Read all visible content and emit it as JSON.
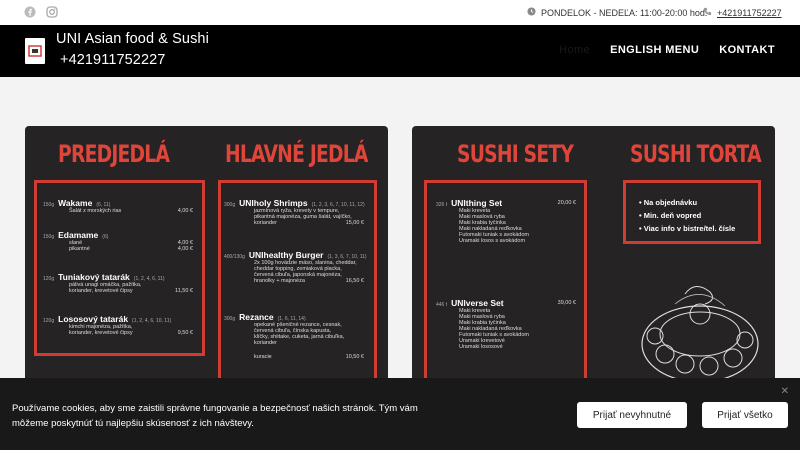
{
  "topbar": {
    "hours": "PONDELOK - NEDEĽA: 11:00-20:00 hod.",
    "phone": "+421911752227"
  },
  "header": {
    "brand_name": "UNI Asian food & Sushi",
    "brand_phone": "+421911752227",
    "nav": {
      "home": "Home",
      "english_menu": "ENGLISH MENU",
      "contact": "KONTAKT"
    }
  },
  "menu_left": {
    "title_1": "PREDJEDLÁ",
    "title_2": "HLAVNÉ JEDLÁ",
    "starters": [
      {
        "gram": "150g",
        "name": "Wakame",
        "alg": "(6, 11)",
        "lines": [
          {
            "text": "Šalát z morských rias",
            "price": "4,00 €"
          }
        ]
      },
      {
        "gram": "150g",
        "name": "Edamame",
        "alg": "(6)",
        "lines": [
          {
            "text": "slané",
            "price": "4,00 €"
          },
          {
            "text": "pikantné",
            "price": "4,00 €"
          }
        ]
      },
      {
        "gram": "120g",
        "name": "Tuniakový tatarák",
        "alg": "(1, 2, 4, 6, 11)",
        "lines": [
          {
            "text": "pálivá unagi omáčka, pažítka,",
            "price": ""
          },
          {
            "text": "koriander, krevetové čipsy",
            "price": "11,50 €"
          }
        ]
      },
      {
        "gram": "120g",
        "name": "Lososový tatarák",
        "alg": "(1, 2, 4, 6, 10, 11)",
        "lines": [
          {
            "text": "kimchi majonéza, pažítka,",
            "price": ""
          },
          {
            "text": "koriander, krevetové čipsy",
            "price": "9,50 €"
          }
        ]
      }
    ],
    "mains": [
      {
        "gram": "300g",
        "name": "UNIholy Shrimps",
        "alg": "(1, 2, 3, 6, 7, 10, 11, 12)",
        "lines": [
          {
            "text": "jazmínová ryža, krevety v tempure,",
            "price": ""
          },
          {
            "text": "pikantná majonéza, guma šalát, vajíčko,",
            "price": ""
          },
          {
            "text": "koriander",
            "price": "15,00 €"
          }
        ]
      },
      {
        "gram": "400/130g",
        "name": "UNIhealthy Burger",
        "alg": "(1, 3, 6, 7, 10, 11)",
        "lines": [
          {
            "text": "2x 100g hovädzie mäso, slanina, cheddar,",
            "price": ""
          },
          {
            "text": "cheddar topping, zemiaková placka,",
            "price": ""
          },
          {
            "text": "červená cibuľa, japonská majonéza,",
            "price": ""
          },
          {
            "text": "hranolky + majonéza",
            "price": "16,50 €"
          }
        ]
      },
      {
        "gram": "300g",
        "name": "Rezance",
        "alg": "(1, 6, 11, 14)",
        "lines": [
          {
            "text": "opekané pšeničné rezance, cesnak,",
            "price": ""
          },
          {
            "text": "červená cibuľa, čínska kapusta,",
            "price": ""
          },
          {
            "text": "klíčky, shiitake, cuketa, jarná cibuľka,",
            "price": ""
          },
          {
            "text": "koriander",
            "price": ""
          },
          {
            "text": "kuracie",
            "price": "10,50 €"
          }
        ]
      }
    ]
  },
  "menu_right": {
    "title_1": "SUSHI SETY",
    "title_2": "SUSHI TORTA",
    "sets": [
      {
        "gram": "326 t",
        "name": "UNIthing Set",
        "price": "20,00 €",
        "lines": [
          "Maki kreveta",
          "Maki maslová ryba",
          "Maki krabia tyčinka",
          "Maki nakladaná reďkovka",
          "Futomaki tuniak s avokádom",
          "Uramaki losos s avokádom"
        ]
      },
      {
        "gram": "446 t",
        "name": "UNIverse Set",
        "price": "39,00 €",
        "lines": [
          "Maki kreveta",
          "Maki maslová ryba",
          "Maki krabia tyčinka",
          "Maki nakladaná reďkovka",
          "Futomaki tuniak s avokádom",
          "Uramaki krevetové",
          "Uramaki lososové"
        ]
      }
    ],
    "cake_info": [
      "Na objednávku",
      "Min. deň vopred",
      "Viac info v bistre/tel. čísle"
    ]
  },
  "cookie": {
    "text": "Používame cookies, aby sme zaistili správne fungovanie a bezpečnosť našich stránok. Tým vám môžeme poskytnúť tú najlepšiu skúsenosť z ich návštevy.",
    "accept_necessary": "Prijať nevyhnutné",
    "accept_all": "Prijať všetko",
    "close": "✕"
  },
  "colors": {
    "accent": "#e0453a",
    "frame": "#d03b32",
    "card_bg": "#262325",
    "header_bg": "#000000"
  }
}
